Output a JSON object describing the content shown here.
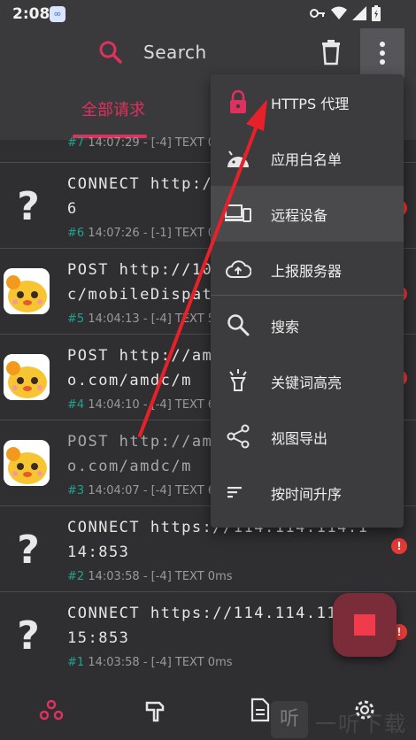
{
  "status": {
    "time": "2:08"
  },
  "appbar": {
    "search_label": "Search"
  },
  "tabs": {
    "active_label": "全部请求"
  },
  "list": {
    "partial_meta_num": "#7",
    "partial_meta_text": "14:07:29 - [-4] TEXT  0",
    "rows": [
      {
        "line1": "CONNECT http:/",
        "line2": "6",
        "num": "#6",
        "meta": "14:07:26 - [-1] TEXT  0",
        "icon": "question-mark"
      },
      {
        "line1": "POST http://10",
        "line2": "c/mobileDispat",
        "num": "#5",
        "meta": "14:04:13 - [-4] TEXT 5",
        "icon": "app-avatar"
      },
      {
        "line1": "POST http://am",
        "line2": "o.com/amdc/m",
        "num": "#4",
        "meta": "14:04:10 - [-4] TEXT 6",
        "icon": "app-avatar"
      },
      {
        "line1": "POST http://am",
        "line2": "o.com/amdc/m",
        "num": "#3",
        "meta": "14:04:07 - [-4] TEXT 6",
        "icon": "app-avatar"
      },
      {
        "line1": "CONNECT https://114.114.114.1",
        "line2": "14:853",
        "num": "#2",
        "meta": "14:03:58 - [-4] TEXT  0ms",
        "icon": "question-mark"
      },
      {
        "line1": "CONNECT https://114.114.11",
        "line2": "15:853",
        "num": "#1",
        "meta": "14:03:58 - [-4] TEXT  0ms",
        "icon": "question-mark"
      }
    ],
    "question_glyph": "?"
  },
  "menu": {
    "items": [
      {
        "label": "HTTPS 代理",
        "icon": "lock-icon"
      },
      {
        "label": "应用白名单",
        "icon": "android-icon"
      },
      {
        "label": "远程设备",
        "icon": "devices-icon"
      },
      {
        "label": "上报服务器",
        "icon": "cloud-upload-icon"
      },
      {
        "label": "搜索",
        "icon": "search-icon"
      },
      {
        "label": "关键词高亮",
        "icon": "highlight-icon"
      },
      {
        "label": "视图导出",
        "icon": "share-icon"
      },
      {
        "label": "按时间升序",
        "icon": "sort-icon"
      }
    ]
  },
  "watermark": {
    "glyph": "听",
    "text": "一听下载"
  },
  "colors": {
    "accent": "#e0305e",
    "teal": "#22a28e",
    "error": "#e53935",
    "fab": "#7a2d38"
  }
}
